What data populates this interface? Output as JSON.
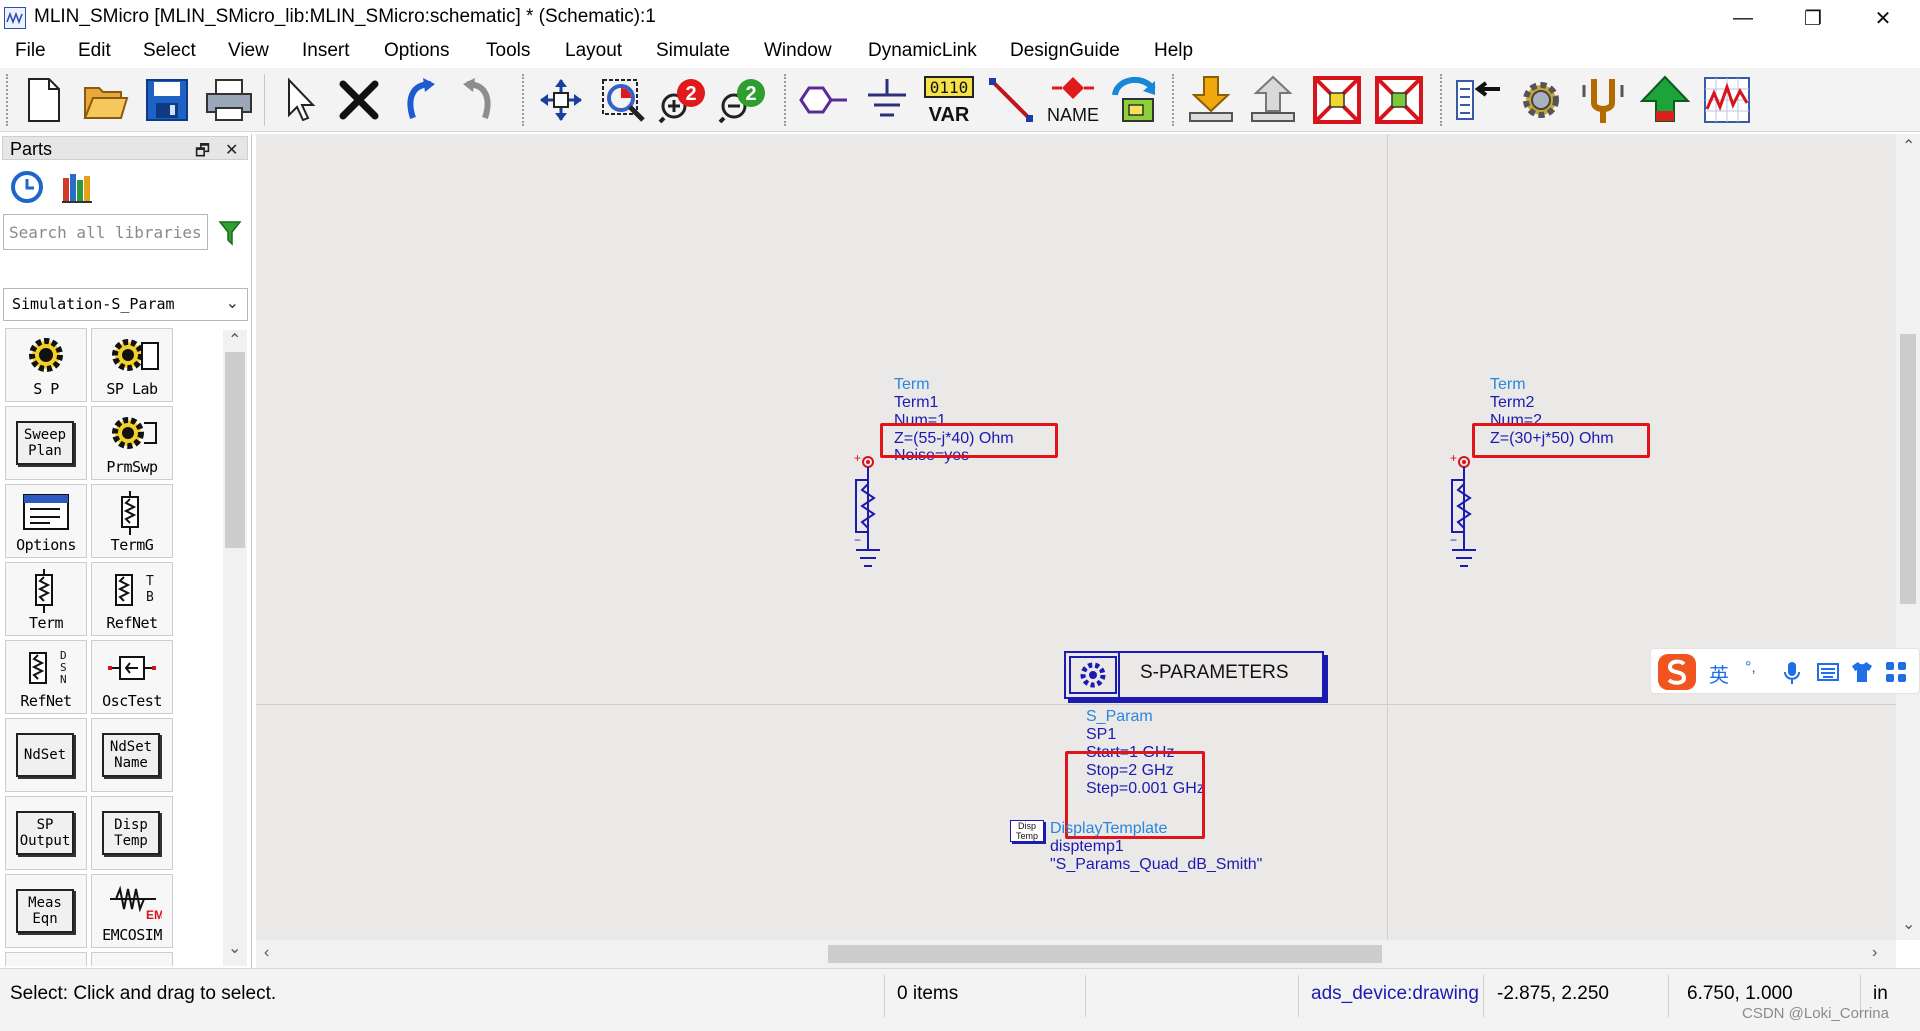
{
  "window": {
    "title": "MLIN_SMicro [MLIN_SMicro_lib:MLIN_SMicro:schematic] * (Schematic):1",
    "minimize": "—",
    "restore": "❐",
    "close": "✕"
  },
  "menu": [
    "File",
    "Edit",
    "Select",
    "View",
    "Insert",
    "Options",
    "Tools",
    "Layout",
    "Simulate",
    "Window",
    "DynamicLink",
    "DesignGuide",
    "Help"
  ],
  "toolbar": {
    "var_label": "VAR",
    "var_bits": "0110",
    "name_label": "NAME",
    "zoom_in_badge": "2",
    "zoom_out_badge": "2"
  },
  "parts_panel": {
    "title": "Parts",
    "float_icon": "🗗",
    "close_icon": "✕",
    "search_placeholder": "Search all libraries",
    "library": "Simulation-S_Param",
    "palette": [
      {
        "label": "S P",
        "icon": "gear-icon"
      },
      {
        "label": "SP Lab",
        "icon": "gear-icon"
      },
      {
        "label": "Sweep Plan",
        "icon": "box-text"
      },
      {
        "label": "PrmSwp",
        "icon": "gear-icon"
      },
      {
        "label": "Options",
        "icon": "options-icon"
      },
      {
        "label": "TermG",
        "icon": "term-icon"
      },
      {
        "label": "Term",
        "icon": "term-icon"
      },
      {
        "label": "RefNet",
        "icon": "term-icon"
      },
      {
        "label": "RefNet",
        "icon": "term-icon"
      },
      {
        "label": "OscTest",
        "icon": "osc-icon"
      },
      {
        "label": "NdSet",
        "icon": "box-text"
      },
      {
        "label": "NdSet Name",
        "icon": "box-text"
      },
      {
        "label": "SP Output",
        "icon": "box-text"
      },
      {
        "label": "Disp Temp",
        "icon": "box-text"
      },
      {
        "label": "Meas Eqn",
        "icon": "box-text"
      },
      {
        "label": "EMCOSIM",
        "icon": "emcosim-icon"
      }
    ],
    "box_texts": {
      "sweep_plan": [
        "Sweep",
        "Plan"
      ],
      "ndset": [
        "NdSet"
      ],
      "ndset_name": [
        "NdSet",
        "Name"
      ],
      "sp_output": [
        "SP",
        "Output"
      ],
      "disp_temp": [
        "Disp",
        "Temp"
      ],
      "meas_eqn": [
        "Meas",
        "Eqn"
      ]
    },
    "tb_letters": [
      "T",
      "B"
    ],
    "dsn_letters": [
      "D",
      "S",
      "N"
    ],
    "em_badge": "EM"
  },
  "schematic": {
    "term1": {
      "type": "Term",
      "name": "Term1",
      "num": "Num=1",
      "z": "Z=(55-j*40) Ohm",
      "noise": "Noise=yes"
    },
    "term2": {
      "type": "Term",
      "name": "Term2",
      "num": "Num=2",
      "z": "Z=(30+j*50) Ohm"
    },
    "sparam_block_title": "S-PARAMETERS",
    "sparam": {
      "type": "S_Param",
      "name": "SP1",
      "start": "Start=1 GHz",
      "stop": "Stop=2 GHz",
      "step": "Step=0.001 GHz"
    },
    "display_template": {
      "icon_text": [
        "Disp",
        "Temp"
      ],
      "type": "DisplayTemplate",
      "name": "disptemp1",
      "value": "\"S_Params_Quad_dB_Smith\""
    }
  },
  "statusbar": {
    "hint": "Select: Click and drag to select.",
    "items": "0 items",
    "layer": "ads_device:drawing",
    "coord1": "-2.875, 2.250",
    "coord2": "6.750, 1.000",
    "units": "in",
    "watermark": "CSDN @Loki_Corrina"
  },
  "ime": {
    "lang": "英",
    "punct": "°,"
  }
}
